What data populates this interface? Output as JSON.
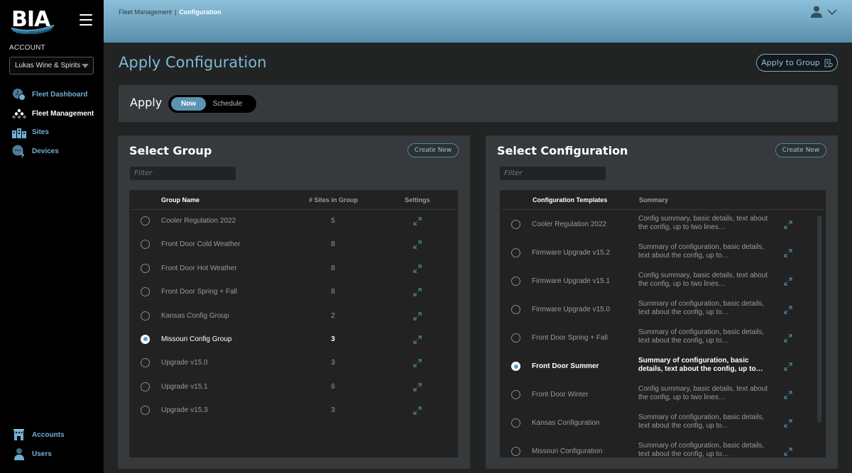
{
  "brand": {
    "logo_text": "BIA"
  },
  "sidebar": {
    "account_label": "ACCOUNT",
    "account_selected": "Lukas Wine & Spirits",
    "nav_top": [
      {
        "label": "Fleet Dashboard",
        "icon": "dashboard-icon",
        "active": false
      },
      {
        "label": "Fleet Management",
        "icon": "fleet-management-icon",
        "active": true
      },
      {
        "label": "Sites",
        "icon": "sites-icon",
        "active": false
      },
      {
        "label": "Devices",
        "icon": "devices-icon",
        "active": false
      }
    ],
    "nav_bottom": [
      {
        "label": "Accounts",
        "icon": "accounts-icon"
      },
      {
        "label": "Users",
        "icon": "users-icon"
      }
    ]
  },
  "header": {
    "breadcrumb": [
      "Fleet Management",
      "Configuration"
    ],
    "breadcrumb_separator": "|"
  },
  "page": {
    "title": "Apply Configuration",
    "apply_to_group_label": "Apply to Group"
  },
  "apply_bar": {
    "label": "Apply",
    "options": [
      "Now",
      "Schedule"
    ],
    "selected": "Now"
  },
  "group_panel": {
    "title": "Select Group",
    "create_label": "Create New",
    "filter_placeholder": "Filter",
    "columns": [
      "Group Name",
      "# Sites in Group",
      "Settings"
    ],
    "rows": [
      {
        "name": "Cooler Regulation 2022",
        "sites": "5",
        "selected": false
      },
      {
        "name": "Front Door Cold Weather",
        "sites": "8",
        "selected": false
      },
      {
        "name": "Front Door Hot Weather",
        "sites": "8",
        "selected": false
      },
      {
        "name": "Front Door Spring + Fall",
        "sites": "8",
        "selected": false
      },
      {
        "name": "Kansas Config Group",
        "sites": "2",
        "selected": false
      },
      {
        "name": "Missouri Config Group",
        "sites": "3",
        "selected": true
      },
      {
        "name": "Upgrade v15.0",
        "sites": "3",
        "selected": false
      },
      {
        "name": "Upgrade v15.1",
        "sites": "6",
        "selected": false
      },
      {
        "name": "Upgrade v15.3",
        "sites": "3",
        "selected": false
      }
    ]
  },
  "config_panel": {
    "title": "Select Configuration",
    "create_label": "Create New",
    "filter_placeholder": "Filter",
    "columns": [
      "Configuration Templates",
      "Summary"
    ],
    "rows": [
      {
        "name": "Cooler Regulation 2022",
        "summary": "Config summary, basic details, text about the config, up to two lines…",
        "selected": false
      },
      {
        "name": "Firmware Upgrade v15.2",
        "summary": "Summary of configuration, basic details, text about the config, up to…",
        "selected": false
      },
      {
        "name": "Firmware Upgrade v15.1",
        "summary": "Config summary, basic details, text about the config, up to two lines…",
        "selected": false
      },
      {
        "name": "Firmware Upgrade v15.0",
        "summary": "Summary of configuration, basic details, text about the config, up to…",
        "selected": false
      },
      {
        "name": "Front Door Spring + Fall",
        "summary": "Summary of configuration, basic details, text about the config, up to…",
        "selected": false
      },
      {
        "name": "Front Door Summer",
        "summary": "Summary of configuration, basic details, text about the config, up to…",
        "selected": true
      },
      {
        "name": "Front Door Winter",
        "summary": "Config summary, basic details, text about the config, up to two lines…",
        "selected": false
      },
      {
        "name": "Kansas Configuration",
        "summary": "Summary of configuration, basic details, text about the config, up to…",
        "selected": false
      },
      {
        "name": "Missouri Configuration",
        "summary": "Summary of configuration, basic details, text about the config, up to…",
        "selected": false
      }
    ]
  },
  "colors": {
    "accent": "#6fb0d2",
    "header_top": "#8cc0da",
    "header_bottom": "#5a8fab",
    "panel": "#363a3c",
    "table": "#222222",
    "toggle_active": "#5b93b3"
  }
}
